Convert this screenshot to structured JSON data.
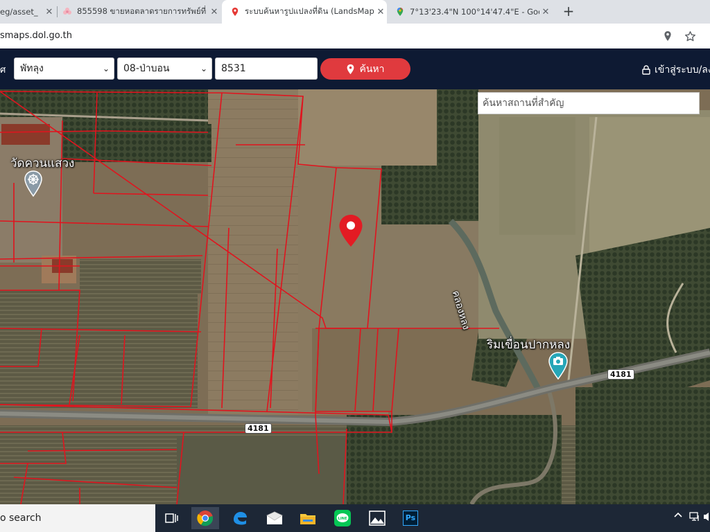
{
  "tabs": [
    {
      "title": "eg/asset_",
      "favicon": "document-icon"
    },
    {
      "title": "855598 ขายหอตลาดรายการทรัพย์ที่",
      "favicon": "flower-icon"
    },
    {
      "title": "ระบบค้นหารูปแปลงที่ดิน (LandsMaps",
      "favicon": "map-pin-icon",
      "active": true
    },
    {
      "title": "7°13'23.4\"N 100°14'47.4\"E - Goo",
      "favicon": "google-maps-icon"
    }
  ],
  "new_tab_label": "+",
  "address_bar": {
    "url": "smaps.dol.go.th"
  },
  "header": {
    "prefix": "ศ",
    "province": "พัทลุง",
    "district": "08-ป่าบอน",
    "parcel_number": "8531",
    "search_button": "ค้นหา",
    "login_link": "เข้าสู่ระบบ/ลง"
  },
  "map": {
    "place_search_placeholder": "ค้นหาสถานที่สำคัญ",
    "labels": {
      "temple": "วัดควนแสวง",
      "canal": "คลองหลง",
      "dam_viewpoint": "ริมเขื่อนปากหลง"
    },
    "road_shields": [
      "4181",
      "4181"
    ],
    "marker": "map-pin-icon",
    "colors": {
      "parcel_lines": "#e0141e",
      "marker": "#e31b23",
      "header_bg": "#0e1a33",
      "search_button": "#e03a3e"
    }
  },
  "taskbar": {
    "search_text": "o search",
    "apps": [
      "task-view-icon",
      "chrome-icon",
      "edge-icon",
      "mail-icon",
      "file-explorer-icon",
      "line-icon",
      "photos-icon",
      "photoshop-icon"
    ],
    "photoshop_label": "Ps",
    "line_label": "LINE"
  }
}
